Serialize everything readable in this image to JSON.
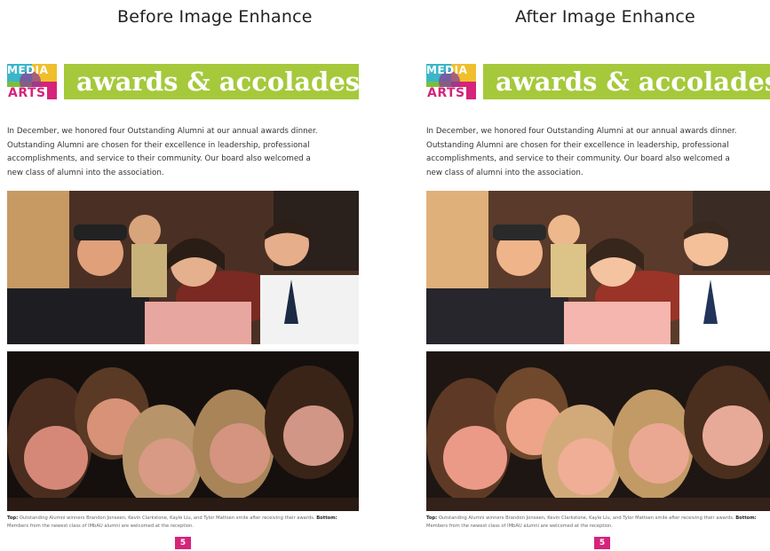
{
  "headings": {
    "before": "Before Image Enhance",
    "after": "After Image Enhance"
  },
  "page": {
    "logo_top": "MEDIA",
    "logo_bottom": "ARTS",
    "banner_title": "awards & accolades",
    "intro_lines": [
      "In December, we honored four Outstanding Alumni at our annual awards dinner.",
      "Outstanding Alumni are chosen for their excellence in leadership, professional",
      "accomplishments, and service to their community. Our board also welcomed a",
      "new class of alumni into the association."
    ],
    "caption_top_label": "Top:",
    "caption_top_text": " Outstanding Alumni winners Brandon Jonseen, Kevin Clarkstone, Kayle Liu, and Tylor Mattsen smile after receiving their awards.",
    "caption_bottom_label": "Bottom:",
    "caption_bottom_text": " Members from the newest class of IMbAU alumni are welcomed at the reception.",
    "page_number": "5"
  },
  "colors": {
    "banner": "#a5c93b",
    "accent_pink": "#d6247a",
    "logo_cyan": "#3ab6c9",
    "logo_yellow": "#f0bf2d",
    "logo_green": "#7bbf3a"
  }
}
